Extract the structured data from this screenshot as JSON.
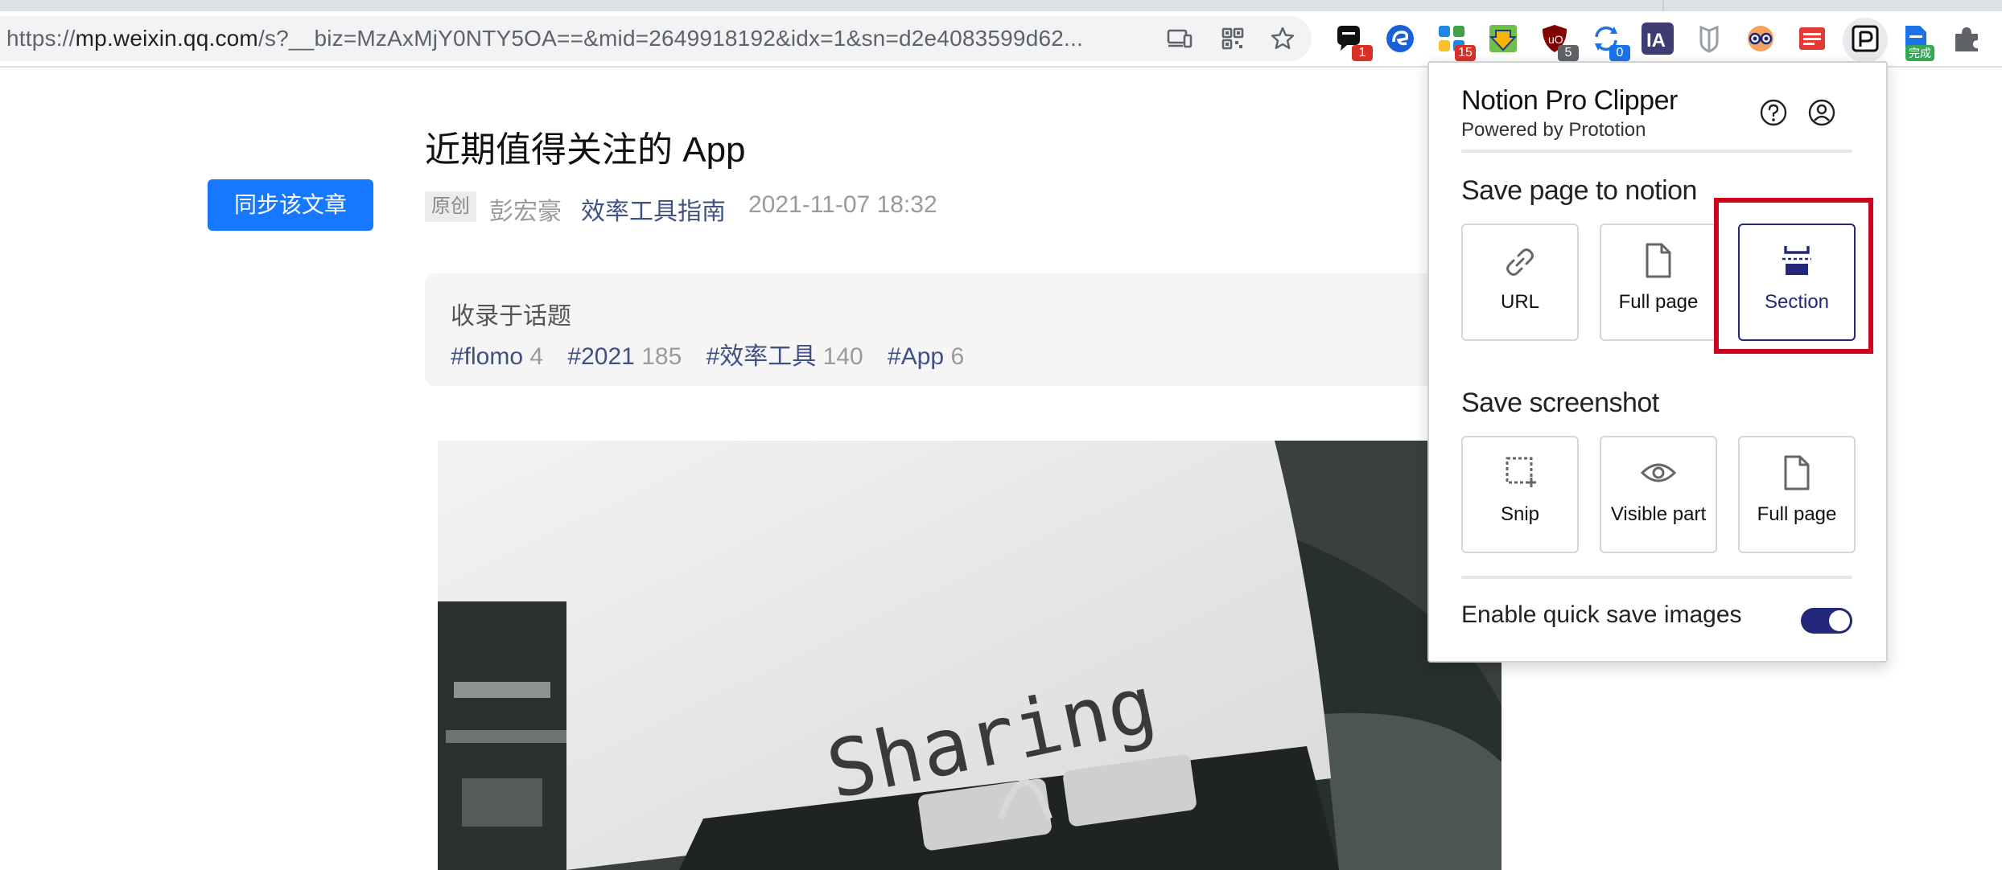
{
  "browser": {
    "url_scheme": "https://",
    "url_host": "mp.weixin.qq.com",
    "url_rest": "/s?__biz=MzAxMjY0NTY5OA==&mid=2649918192&idx=1&sn=d2e4083599d62...",
    "extensions": [
      {
        "name": "notion-web-clipper",
        "badge": "1",
        "badge_color": "#d93025"
      },
      {
        "name": "edge-circle-extension",
        "badge": "",
        "badge_color": ""
      },
      {
        "name": "blocks-extension",
        "badge": "15",
        "badge_color": "#d93025"
      },
      {
        "name": "download-extension",
        "badge": "",
        "badge_color": ""
      },
      {
        "name": "ublock-origin",
        "badge": "5",
        "badge_color": "#5f6368"
      },
      {
        "name": "sync-extension",
        "badge": "0",
        "badge_color": "#1a73e8"
      },
      {
        "name": "ia-writer-extension",
        "badge": "",
        "badge_color": ""
      },
      {
        "name": "shield-extension",
        "badge": "",
        "badge_color": ""
      },
      {
        "name": "glasses-extension",
        "badge": "",
        "badge_color": ""
      },
      {
        "name": "red-notes-extension",
        "badge": "",
        "badge_color": ""
      },
      {
        "name": "notion-pro-clipper",
        "badge": "",
        "badge_color": ""
      },
      {
        "name": "doc-extension",
        "badge": "完成",
        "badge_color": "#34a853"
      },
      {
        "name": "puzzle-icon",
        "badge": "",
        "badge_color": ""
      }
    ]
  },
  "article": {
    "sync_button": "同步该文章",
    "title": "近期值得关注的 App",
    "original_tag": "原创",
    "author": "彭宏豪",
    "account": "效率工具指南",
    "datetime": "2021-11-07 18:32",
    "topics_label": "收录于话题",
    "topics": [
      {
        "tag": "#flomo",
        "count": "4"
      },
      {
        "tag": "#2021",
        "count": "185"
      },
      {
        "tag": "#效率工具",
        "count": "140"
      },
      {
        "tag": "#App",
        "count": "6"
      }
    ],
    "image_text": "Sharing"
  },
  "popup": {
    "title": "Notion Pro Clipper",
    "subtitle": "Powered by Prototion",
    "save_page_heading": "Save page to notion",
    "save_page_options": [
      "URL",
      "Full page",
      "Section"
    ],
    "selected_option": "Section",
    "save_screenshot_heading": "Save screenshot",
    "screenshot_options": [
      "Snip",
      "Visible part",
      "Full page"
    ],
    "toggle_label": "Enable quick save images",
    "toggle_on": true,
    "accent_color": "#24287a",
    "highlight_color": "#d0021b"
  }
}
